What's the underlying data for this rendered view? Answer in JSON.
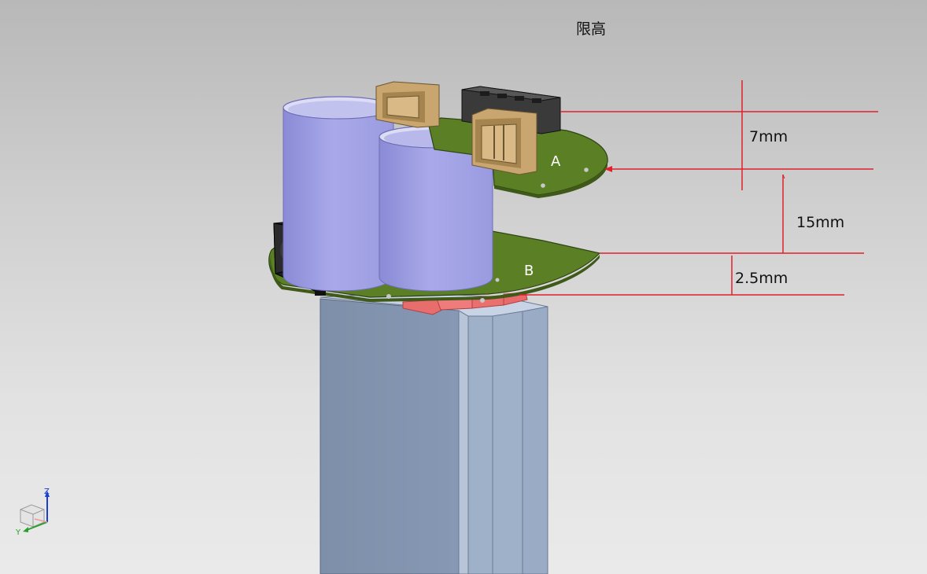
{
  "view": {
    "title": "限高"
  },
  "dimensions": {
    "top_gap": "7mm",
    "board_gap": "15mm",
    "bottom_gap": "2.5mm"
  },
  "boards": {
    "upper_label": "A",
    "lower_label": "B"
  },
  "triad": {
    "z_label": "Z",
    "y_label": "Y"
  },
  "colors": {
    "pcb_green": "#5b7f24",
    "dimension_red": "#e0202a",
    "cylinder_lavender": "#a7a7e6",
    "battery_blue": "#8fa2bf",
    "usb_tan": "#c9a570"
  }
}
